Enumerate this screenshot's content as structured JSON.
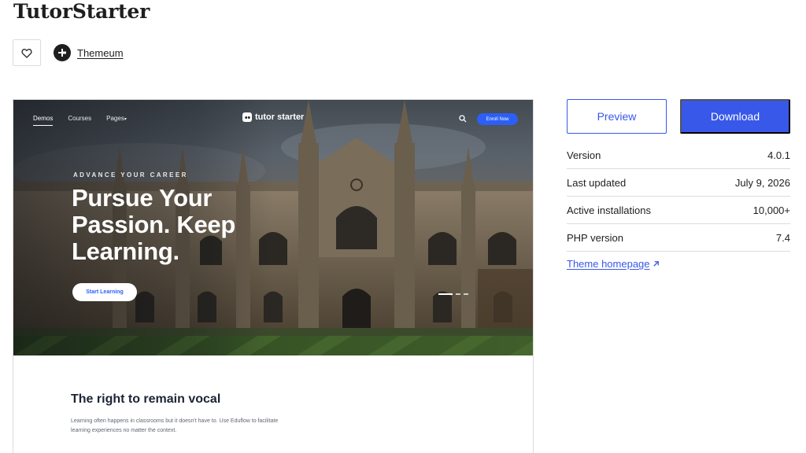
{
  "theme": {
    "title": "TutorStarter",
    "author": "Themeum"
  },
  "icons": {
    "favorite": "heart-icon",
    "author_avatar": "themeum-logo-icon",
    "search": "search-icon",
    "external": "arrow-up-right-icon"
  },
  "preview": {
    "nav": {
      "demos": "Demos",
      "courses": "Courses",
      "pages": "Pages"
    },
    "logo_text": "tutor starter",
    "enroll_label": "Enroll Now",
    "eyebrow": "ADVANCE YOUR CAREER",
    "headline": "Pursue Your Passion. Keep Learning.",
    "start_label": "Start Learning",
    "section_title": "The right to remain vocal",
    "section_text": "Learning often happens in classrooms but it doesn't have to. Use Eduflow to facilitate learning experiences no matter the context."
  },
  "actions": {
    "preview_label": "Preview",
    "download_label": "Download"
  },
  "meta": [
    {
      "label": "Version",
      "value": "4.0.1"
    },
    {
      "label": "Last updated",
      "value": "July 9, 2026"
    },
    {
      "label": "Active installations",
      "value": "10,000+"
    },
    {
      "label": "PHP version",
      "value": "7.4"
    }
  ],
  "homepage_link": "Theme homepage",
  "colors": {
    "accent": "#3858e9",
    "hero_button": "#2c5ff6",
    "border": "#dcdcde",
    "text": "#1e1e1e"
  }
}
